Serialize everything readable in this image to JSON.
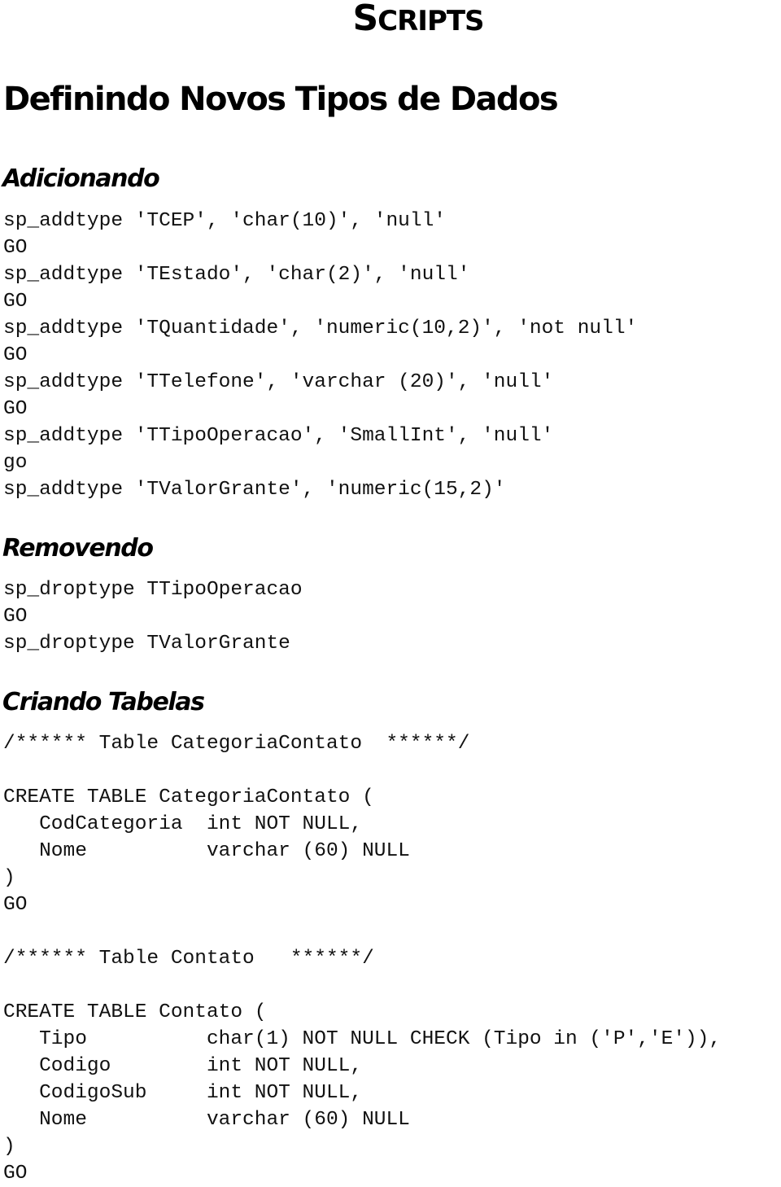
{
  "document": {
    "title_first": "S",
    "title_rest": "CRIPTS",
    "heading": "Definindo Novos Tipos de Dados",
    "sections": [
      {
        "heading": "Adicionando",
        "lines": [
          "sp_addtype 'TCEP', 'char(10)', 'null'",
          "GO",
          "sp_addtype 'TEstado', 'char(2)', 'null'",
          "GO",
          "sp_addtype 'TQuantidade', 'numeric(10,2)', 'not null'",
          "GO",
          "sp_addtype 'TTelefone', 'varchar (20)', 'null'",
          "GO",
          "sp_addtype 'TTipoOperacao', 'SmallInt', 'null'",
          "go",
          "sp_addtype 'TValorGrante', 'numeric(15,2)'"
        ]
      },
      {
        "heading": "Removendo",
        "lines": [
          "sp_droptype TTipoOperacao",
          "GO",
          "sp_droptype TValorGrante"
        ]
      },
      {
        "heading": "Criando Tabelas",
        "lines": [
          "/****** Table CategoriaContato  ******/",
          "",
          "CREATE TABLE CategoriaContato (",
          "   CodCategoria  int NOT NULL,",
          "   Nome          varchar (60) NULL",
          ")",
          "GO",
          "",
          "/****** Table Contato   ******/",
          "",
          "CREATE TABLE Contato (",
          "   Tipo          char(1) NOT NULL CHECK (Tipo in ('P','E')),",
          "   Codigo        int NOT NULL,",
          "   CodigoSub     int NOT NULL,",
          "   Nome          varchar (60) NULL",
          ")",
          "GO"
        ]
      }
    ]
  }
}
